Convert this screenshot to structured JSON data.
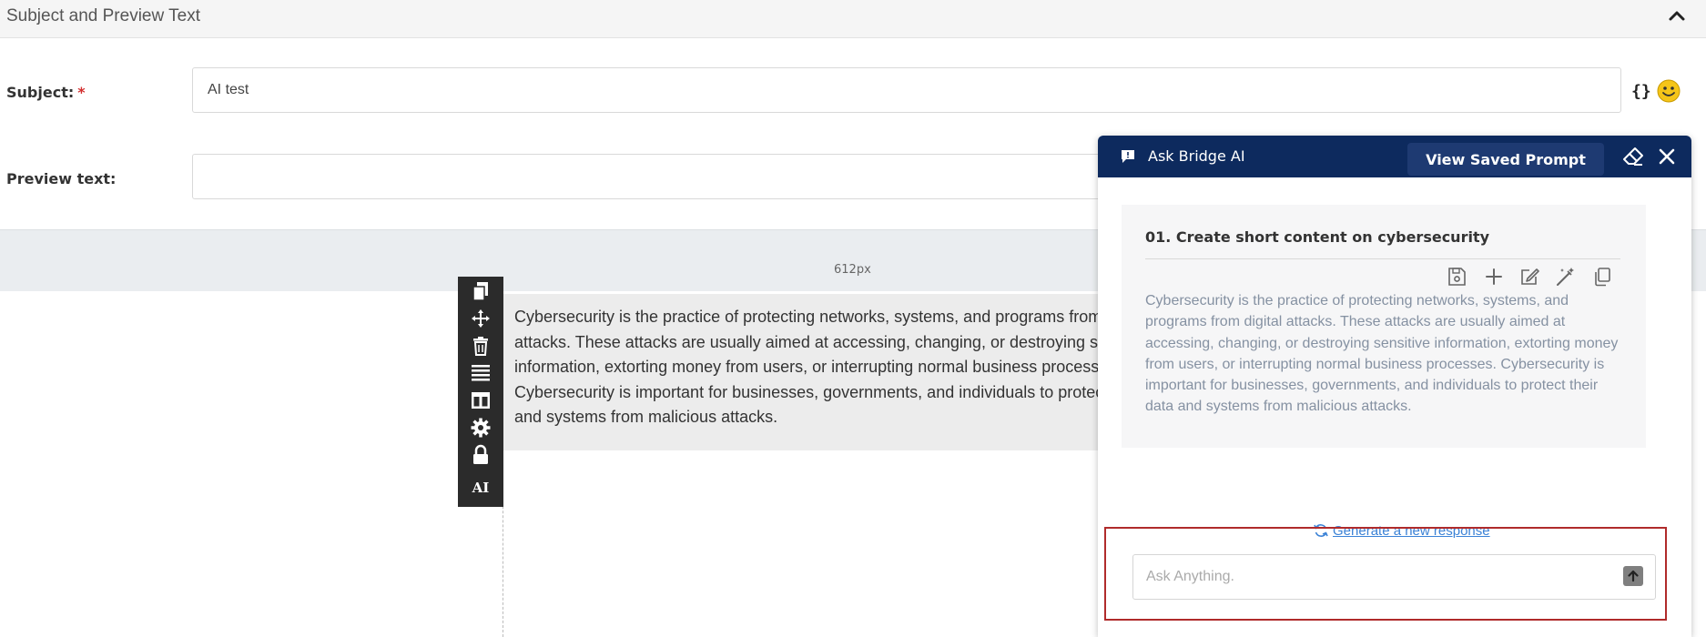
{
  "section": {
    "title": "Subject and Preview Text"
  },
  "form": {
    "subject_label": "Subject:",
    "required_mark": "*",
    "subject_value": "AI test",
    "preview_label": "Preview text:",
    "preview_value": "",
    "merge_tag_symbol": "{}"
  },
  "editor": {
    "width_label": "612px",
    "content_text": "Cybersecurity is the practice of protecting networks, systems, and programs from digital attacks. These attacks are usually aimed at accessing, changing, or destroying sensitive information, extorting money from users, or interrupting normal business processes. Cybersecurity is important for businesses, governments, and individuals to protect their data and systems from malicious attacks.",
    "toolbar": {
      "ai_label": "AI",
      "icons": [
        "copy-icon",
        "move-icon",
        "trash-icon",
        "align-icon",
        "columns-icon",
        "gear-icon",
        "lock-icon"
      ]
    }
  },
  "ai_panel": {
    "title": "Ask Bridge AI",
    "saved_prompt_button": "View Saved Prompt",
    "prompt_title": "01. Create short content on cybersecurity",
    "response_text": "Cybersecurity is the practice of protecting networks, systems, and programs from digital attacks. These attacks are usually aimed at accessing, changing, or destroying sensitive information, extorting money from users, or interrupting normal business processes. Cybersecurity is important for businesses, governments, and individuals to protect their data and systems from malicious attacks.",
    "regenerate_label": "Generate a new response",
    "ask_placeholder": "Ask Anything.",
    "action_icons": [
      "save-icon",
      "plus-icon",
      "edit-icon",
      "magic-wand-icon",
      "copy-icon"
    ]
  },
  "colors": {
    "header_bg": "#0d2a5e",
    "button_bg": "#1e3a72",
    "highlight": "#b02b2b",
    "link": "#3b82d6"
  }
}
